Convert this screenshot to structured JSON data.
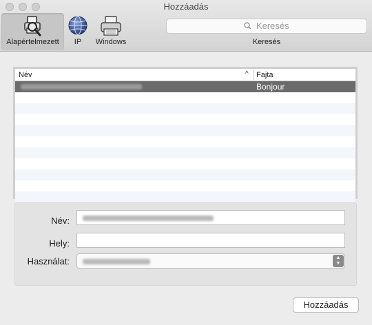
{
  "window": {
    "title": "Hozzáadás"
  },
  "toolbar": {
    "tabs": [
      {
        "label": "Alapértelmezett",
        "icon": "default-printer-search-icon",
        "selected": true
      },
      {
        "label": "IP",
        "icon": "ip-globe-icon",
        "selected": false
      },
      {
        "label": "Windows",
        "icon": "windows-printer-icon",
        "selected": false
      }
    ],
    "search": {
      "placeholder": "Keresés",
      "caption": "Keresés",
      "icon": "search-icon"
    }
  },
  "list": {
    "columns": {
      "name": "Név",
      "kind": "Fajta"
    },
    "sort_indicator": "^",
    "rows": [
      {
        "kind": "Bonjour",
        "selected": true
      }
    ]
  },
  "form": {
    "name_label": "Név:",
    "location_label": "Hely:",
    "location_value": "",
    "use_label": "Használat:"
  },
  "buttons": {
    "add": "Hozzáadás"
  },
  "colors": {
    "selected_row": "#6b6b6b",
    "toolbar_bg": "#d8d8d8",
    "window_bg": "#ececec"
  }
}
